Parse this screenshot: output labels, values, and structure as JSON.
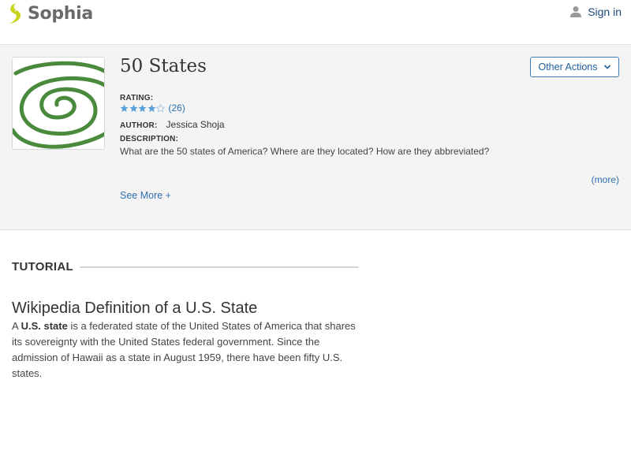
{
  "header": {
    "logo_text": "Sophia",
    "brand_color": "#c8d41f",
    "signin_label": "Sign in"
  },
  "resource": {
    "title": "50 States",
    "other_actions_label": "Other Actions",
    "rating_label": "RATING:",
    "rating_stars": 4,
    "rating_max": 5,
    "rating_count": "(26)",
    "author_label": "AUTHOR:",
    "author_name": "Jessica Shoja",
    "description_label": "DESCRIPTION:",
    "description": "What are the 50 states of America?  Where are they located?  How are they abbreviated?",
    "more_link": "(more)",
    "see_more": "See More +"
  },
  "tutorial": {
    "section_label": "TUTORIAL",
    "article_title": "Wikipedia Definition of a U.S. State",
    "body_prefix": "A ",
    "body_bold": "U.S. state",
    "body_rest": " is a federated state of the United States of America that shares its sovereignty with the United States federal government. Since the admission of Hawaii as a state in August 1959, there have been fifty U.S. states."
  }
}
